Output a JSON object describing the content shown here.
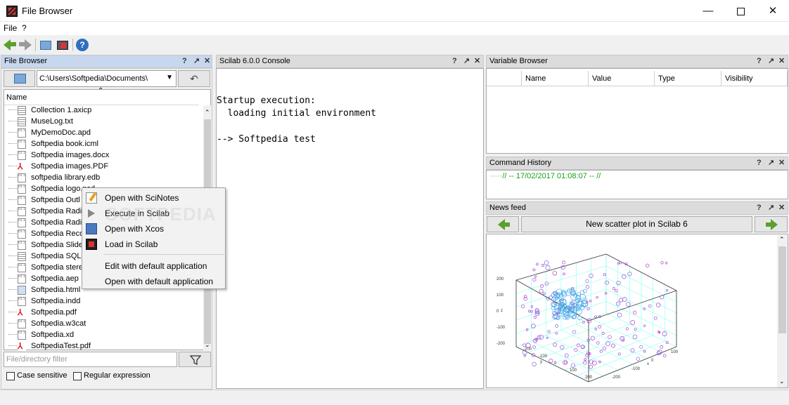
{
  "window": {
    "title": "File Browser",
    "minimize": "—",
    "close": "✕"
  },
  "menu": {
    "file": "File",
    "help": "?"
  },
  "panel_ctrls": {
    "help": "?",
    "undock": "↗",
    "close": "✕"
  },
  "file_browser": {
    "title": "File Browser",
    "path": "C:\\Users\\Softpedia\\Documents\\",
    "column_name": "Name",
    "files": [
      {
        "name": "Collection 1.axicp",
        "icon": "doc"
      },
      {
        "name": "MuseLog.txt",
        "icon": "doc"
      },
      {
        "name": "MyDemoDoc.apd",
        "icon": "bin"
      },
      {
        "name": "Softpedia book.icml",
        "icon": "bin"
      },
      {
        "name": "Softpedia images.docx",
        "icon": "bin"
      },
      {
        "name": "Softpedia images.PDF",
        "icon": "pdf"
      },
      {
        "name": "softpedia library.edb",
        "icon": "bin"
      },
      {
        "name": "Softpedia logo.psd",
        "icon": "bin"
      },
      {
        "name": "Softpedia Outl",
        "icon": "bin"
      },
      {
        "name": "Softpedia Radi",
        "icon": "bin"
      },
      {
        "name": "Softpedia Radi",
        "icon": "bin"
      },
      {
        "name": "Softpedia Reco",
        "icon": "bin"
      },
      {
        "name": "Softpedia Slide",
        "icon": "bin"
      },
      {
        "name": "Softpedia SQL.",
        "icon": "doc"
      },
      {
        "name": "Softpedia stere",
        "icon": "bin"
      },
      {
        "name": "Softpedia.aep",
        "icon": "bin"
      },
      {
        "name": "Softpedia.html",
        "icon": "web"
      },
      {
        "name": "Softpedia.indd",
        "icon": "bin"
      },
      {
        "name": "Softpedia.pdf",
        "icon": "pdf"
      },
      {
        "name": "Softpedia.w3cat",
        "icon": "bin"
      },
      {
        "name": "Softpedia.xd",
        "icon": "bin"
      },
      {
        "name": "SoftpediaTest.pdf",
        "icon": "pdf"
      }
    ],
    "filter_placeholder": "File/directory filter",
    "case_sensitive": "Case sensitive",
    "regex": "Regular expression"
  },
  "context_menu": {
    "items": [
      "Open with SciNotes",
      "Execute in Scilab",
      "Open with Xcos",
      "Load in Scilab",
      "Edit with default application",
      "Open with default application"
    ]
  },
  "console": {
    "title": "Scilab 6.0.0 Console",
    "lines": [
      "Startup execution:",
      "  loading initial environment",
      "",
      "--> Softpedia test"
    ]
  },
  "variable_browser": {
    "title": "Variable Browser",
    "columns": [
      "",
      "Name",
      "Value",
      "Type",
      "Visibility"
    ]
  },
  "command_history": {
    "title": "Command History",
    "entry": "// -- 17/02/2017 01:08:07 -- //"
  },
  "news_feed": {
    "title": "News feed",
    "headline": "New scatter plot in Scilab 6",
    "plot_ticks_z": [
      "200",
      "100",
      "0",
      "-100",
      "-200"
    ],
    "plot_ticks_y": [
      "-200",
      "-100",
      "0",
      "100",
      "200"
    ],
    "plot_ticks_x": [
      "-200",
      "-100",
      "0",
      "100"
    ],
    "axis_x": "x",
    "axis_y": "y",
    "axis_z": "z"
  },
  "colors": {
    "accent_panel": "#c6d7ee",
    "history_green": "#18a018",
    "nav_green": "#5aa02c"
  },
  "watermark": "SOFTPEDIA"
}
